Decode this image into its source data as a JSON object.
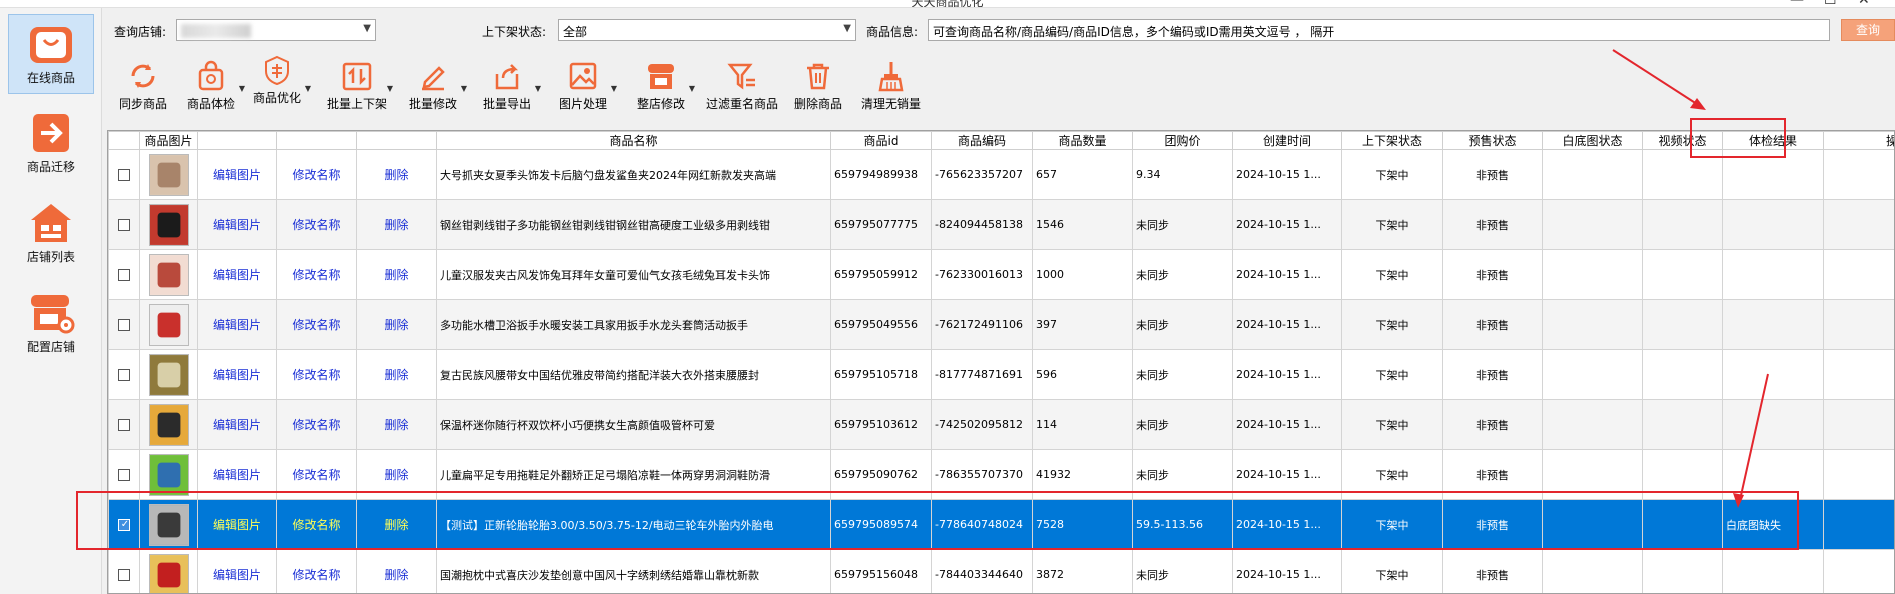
{
  "window": {
    "title": "天天商品优化"
  },
  "sidebar": {
    "items": [
      {
        "label": "在线商品",
        "icon": "shopping-bag-icon",
        "active": true
      },
      {
        "label": "商品迁移",
        "icon": "arrow-right-icon",
        "active": false
      },
      {
        "label": "店铺列表",
        "icon": "store-icon",
        "active": false
      },
      {
        "label": "配置店铺",
        "icon": "store-settings-icon",
        "active": false
      }
    ]
  },
  "filters": {
    "store_label": "查询店铺:",
    "store_value": "...",
    "status_label": "上下架状态:",
    "status_value": "全部",
    "info_label": "商品信息:",
    "info_placeholder": "可查询商品名称/商品编码/商品ID信息，多个编码或ID需用英文逗号 ， 隔开",
    "query_button": "查询"
  },
  "toolbar": [
    {
      "label": "同步商品",
      "icon": "sync-icon"
    },
    {
      "label": "商品体检",
      "icon": "bag-check-icon"
    },
    {
      "label": "商品优化",
      "icon": "optimize-icon"
    },
    {
      "label": "批量上下架",
      "icon": "up-down-icon"
    },
    {
      "label": "批量修改",
      "icon": "edit-pen-icon"
    },
    {
      "label": "批量导出",
      "icon": "export-icon"
    },
    {
      "label": "图片处理",
      "icon": "image-icon"
    },
    {
      "label": "整店修改",
      "icon": "shop-edit-icon"
    },
    {
      "label": "过滤重名商品",
      "icon": "filter-icon"
    },
    {
      "label": "删除商品",
      "icon": "trash-icon"
    },
    {
      "label": "清理无销量",
      "icon": "broom-icon"
    }
  ],
  "table": {
    "columns": [
      "",
      "商品图片",
      "",
      "",
      "",
      "商品名称",
      "商品id",
      "商品编码",
      "商品数量",
      "团购价",
      "创建时间",
      "上下架状态",
      "预售状态",
      "白底图状态",
      "视频状态",
      "体检结果",
      "操作信息"
    ],
    "action_labels": {
      "edit_image": "编辑图片",
      "rename": "修改名称",
      "delete": "删除"
    },
    "rows": [
      {
        "name": "大号抓夹女夏季头饰发卡后脑勺盘发鲨鱼夹2024年网红新款发夹高端",
        "id": "659794989938",
        "code": "-765623357207",
        "qty": "657",
        "price": "9.34",
        "created": "2024-10-15 1...",
        "shelf": "下架中",
        "presale": "非预售",
        "white_bg": "",
        "video": "",
        "check": "",
        "ops": "",
        "selected": false
      },
      {
        "name": "钢丝钳剥线钳子多功能钢丝钳剥线钳钢丝钳高硬度工业级多用剥线钳",
        "id": "659795077775",
        "code": "-824094458138",
        "qty": "1546",
        "price": "未同步",
        "created": "2024-10-15 1...",
        "shelf": "下架中",
        "presale": "非预售",
        "white_bg": "",
        "video": "",
        "check": "",
        "ops": "",
        "selected": false
      },
      {
        "name": "儿童汉服发夹古风发饰兔耳拜年女童可爱仙气女孩毛绒兔耳发卡头饰",
        "id": "659795059912",
        "code": "-762330016013",
        "qty": "1000",
        "price": "未同步",
        "created": "2024-10-15 1...",
        "shelf": "下架中",
        "presale": "非预售",
        "white_bg": "",
        "video": "",
        "check": "",
        "ops": "",
        "selected": false
      },
      {
        "name": "多功能水槽卫浴扳手水暖安装工具家用扳手水龙头套筒活动扳手",
        "id": "659795049556",
        "code": "-762172491106",
        "qty": "397",
        "price": "未同步",
        "created": "2024-10-15 1...",
        "shelf": "下架中",
        "presale": "非预售",
        "white_bg": "",
        "video": "",
        "check": "",
        "ops": "",
        "selected": false
      },
      {
        "name": "复古民族风腰带女中国结优雅皮带简约搭配洋装大衣外搭束腰腰封",
        "id": "659795105718",
        "code": "-817774871691",
        "qty": "596",
        "price": "未同步",
        "created": "2024-10-15 1...",
        "shelf": "下架中",
        "presale": "非预售",
        "white_bg": "",
        "video": "",
        "check": "",
        "ops": "",
        "selected": false
      },
      {
        "name": "保温杯迷你随行杯双饮杯小巧便携女生高颜值吸管杯可爱",
        "id": "659795103612",
        "code": "-742502095812",
        "qty": "114",
        "price": "未同步",
        "created": "2024-10-15 1...",
        "shelf": "下架中",
        "presale": "非预售",
        "white_bg": "",
        "video": "",
        "check": "",
        "ops": "",
        "selected": false
      },
      {
        "name": "儿童扁平足专用拖鞋足外翻矫正足弓塌陷凉鞋一体两穿男洞洞鞋防滑",
        "id": "659795090762",
        "code": "-786355707370",
        "qty": "41932",
        "price": "未同步",
        "created": "2024-10-15 1...",
        "shelf": "下架中",
        "presale": "非预售",
        "white_bg": "",
        "video": "",
        "check": "",
        "ops": "",
        "selected": false
      },
      {
        "name": "【测试】正新轮胎轮胎3.00/3.50/3.75-12/电动三轮车外胎内外胎电",
        "id": "659795089574",
        "code": "-778640748024",
        "qty": "7528",
        "price": "59.5-113.56",
        "created": "2024-10-15 1...",
        "shelf": "下架中",
        "presale": "非预售",
        "white_bg": "",
        "video": "",
        "check": "白底图缺失",
        "ops": "",
        "selected": true
      },
      {
        "name": "国潮抱枕中式喜庆沙发垫创意中国风十字绣刺绣结婚靠山靠枕新款",
        "id": "659795156048",
        "code": "-784403344640",
        "qty": "3872",
        "price": "未同步",
        "created": "2024-10-15 1...",
        "shelf": "下架中",
        "presale": "非预售",
        "white_bg": "",
        "video": "",
        "check": "",
        "ops": "",
        "selected": false
      }
    ]
  },
  "colors": {
    "accent": "#0078d7",
    "link": "#1a2fd6",
    "annotation": "#e3262d",
    "query_button": "#f5a27a",
    "icon_orange": "#ef6a3a"
  }
}
